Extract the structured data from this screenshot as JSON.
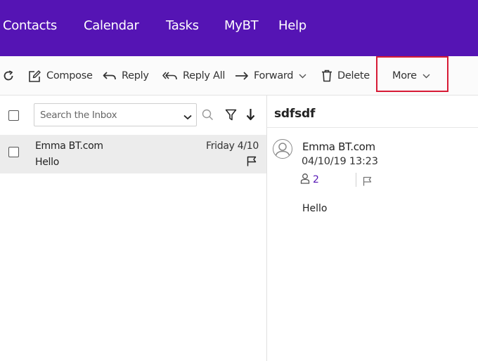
{
  "nav": {
    "items": [
      {
        "label": "Contacts"
      },
      {
        "label": "Calendar"
      },
      {
        "label": "Tasks"
      },
      {
        "label": "MyBT"
      },
      {
        "label": "Help"
      }
    ]
  },
  "toolbar": {
    "refresh_icon": "refresh-icon",
    "compose_label": "Compose",
    "reply_label": "Reply",
    "reply_all_label": "Reply All",
    "forward_label": "Forward",
    "delete_label": "Delete",
    "more_label": "More"
  },
  "list": {
    "search_placeholder": "Search the Inbox",
    "messages": [
      {
        "sender": "Emma BT.com",
        "subject": "Hello",
        "date": "Friday 4/10"
      }
    ]
  },
  "reading": {
    "subject": "sdfsdf",
    "from": "Emma BT.com",
    "datetime": "04/10/19 13:23",
    "recipient_count": "2",
    "body": "Hello"
  },
  "colors": {
    "brand": "#5514b4",
    "highlight": "#d71a35"
  }
}
